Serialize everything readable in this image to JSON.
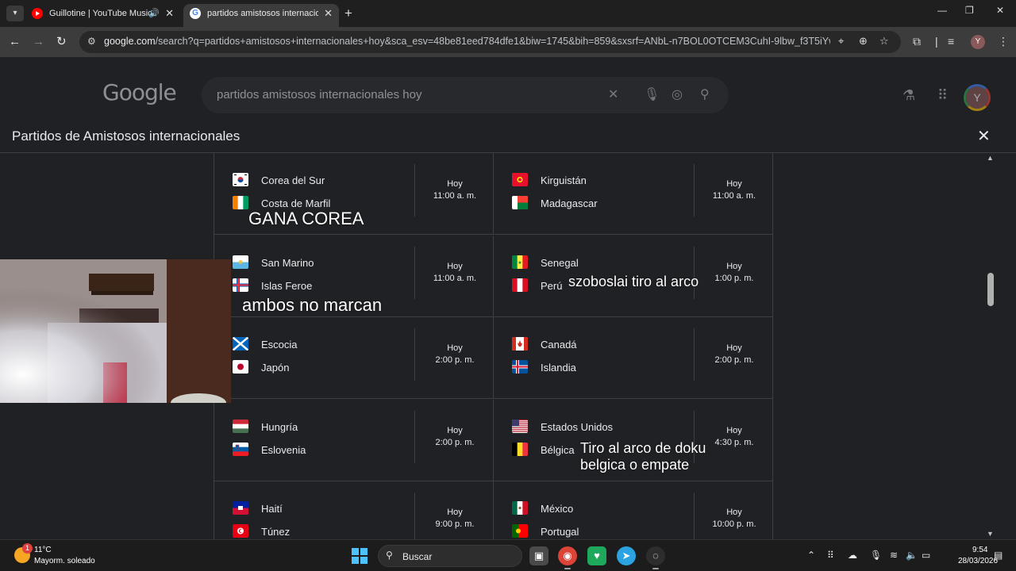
{
  "browser": {
    "tabs": [
      {
        "title": "Guillotine | YouTube Music",
        "favicon": "youtube-music-icon",
        "playing_audio": true
      },
      {
        "title": "partidos amistosos internacionales",
        "favicon": "google-icon",
        "active": true
      }
    ],
    "url_host": "google.com",
    "url_path": "/search?q=partidos+amistosos+internacionales+hoy&sca_esv=48be81eed784dfe1&biw=1745&bih=859&sxsrf=ANbL-n7BOL0OTCEM3CuhI-9lbw_f3T5iYw%3A1774...",
    "profile_initial": "Y"
  },
  "google": {
    "logo": "Google",
    "query": "partidos amistosos internacionales hoy",
    "avatar_initial": "Y"
  },
  "dialog": {
    "title": "Partidos de Amistosos internacionales",
    "matches": [
      {
        "home": {
          "name": "Corea del Sur",
          "flag": "south-korea"
        },
        "away": {
          "name": "Costa de Marfil",
          "flag": "ivory-coast"
        },
        "day": "Hoy",
        "time": "11:00 a. m."
      },
      {
        "home": {
          "name": "Kirguistán",
          "flag": "kyrgyzstan"
        },
        "away": {
          "name": "Madagascar",
          "flag": "madagascar"
        },
        "day": "Hoy",
        "time": "11:00 a. m."
      },
      {
        "home": {
          "name": "San Marino",
          "flag": "san-marino"
        },
        "away": {
          "name": "Islas Feroe",
          "flag": "faroe-islands"
        },
        "day": "Hoy",
        "time": "11:00 a. m."
      },
      {
        "home": {
          "name": "Senegal",
          "flag": "senegal"
        },
        "away": {
          "name": "Perú",
          "flag": "peru"
        },
        "day": "Hoy",
        "time": "1:00 p. m."
      },
      {
        "home": {
          "name": "Escocia",
          "flag": "scotland"
        },
        "away": {
          "name": "Japón",
          "flag": "japan"
        },
        "day": "Hoy",
        "time": "2:00 p. m."
      },
      {
        "home": {
          "name": "Canadá",
          "flag": "canada"
        },
        "away": {
          "name": "Islandia",
          "flag": "iceland"
        },
        "day": "Hoy",
        "time": "2:00 p. m."
      },
      {
        "home": {
          "name": "Hungría",
          "flag": "hungary"
        },
        "away": {
          "name": "Eslovenia",
          "flag": "slovenia"
        },
        "day": "Hoy",
        "time": "2:00 p. m."
      },
      {
        "home": {
          "name": "Estados Unidos",
          "flag": "united-states"
        },
        "away": {
          "name": "Bélgica",
          "flag": "belgium"
        },
        "day": "Hoy",
        "time": "4:30 p. m."
      },
      {
        "home": {
          "name": "Haití",
          "flag": "haiti"
        },
        "away": {
          "name": "Túnez",
          "flag": "tunisia"
        },
        "day": "Hoy",
        "time": "9:00 p. m."
      },
      {
        "home": {
          "name": "México",
          "flag": "mexico"
        },
        "away": {
          "name": "Portugal",
          "flag": "portugal"
        },
        "day": "Hoy",
        "time": "10:00 p. m."
      }
    ]
  },
  "overlays": {
    "note_korea": "GANA COREA",
    "note_sanmarino": "ambos no marcan",
    "note_senegal": "szoboslai tiro al arco",
    "note_usa_line1": "Tiro al arco de doku",
    "note_usa_line2": "belgica o empate"
  },
  "taskbar": {
    "weather_badge": "1",
    "temperature": "11°C",
    "weather": "Mayorm. soleado",
    "search_placeholder": "Buscar",
    "time": "9:54",
    "date": "28/03/2026"
  }
}
